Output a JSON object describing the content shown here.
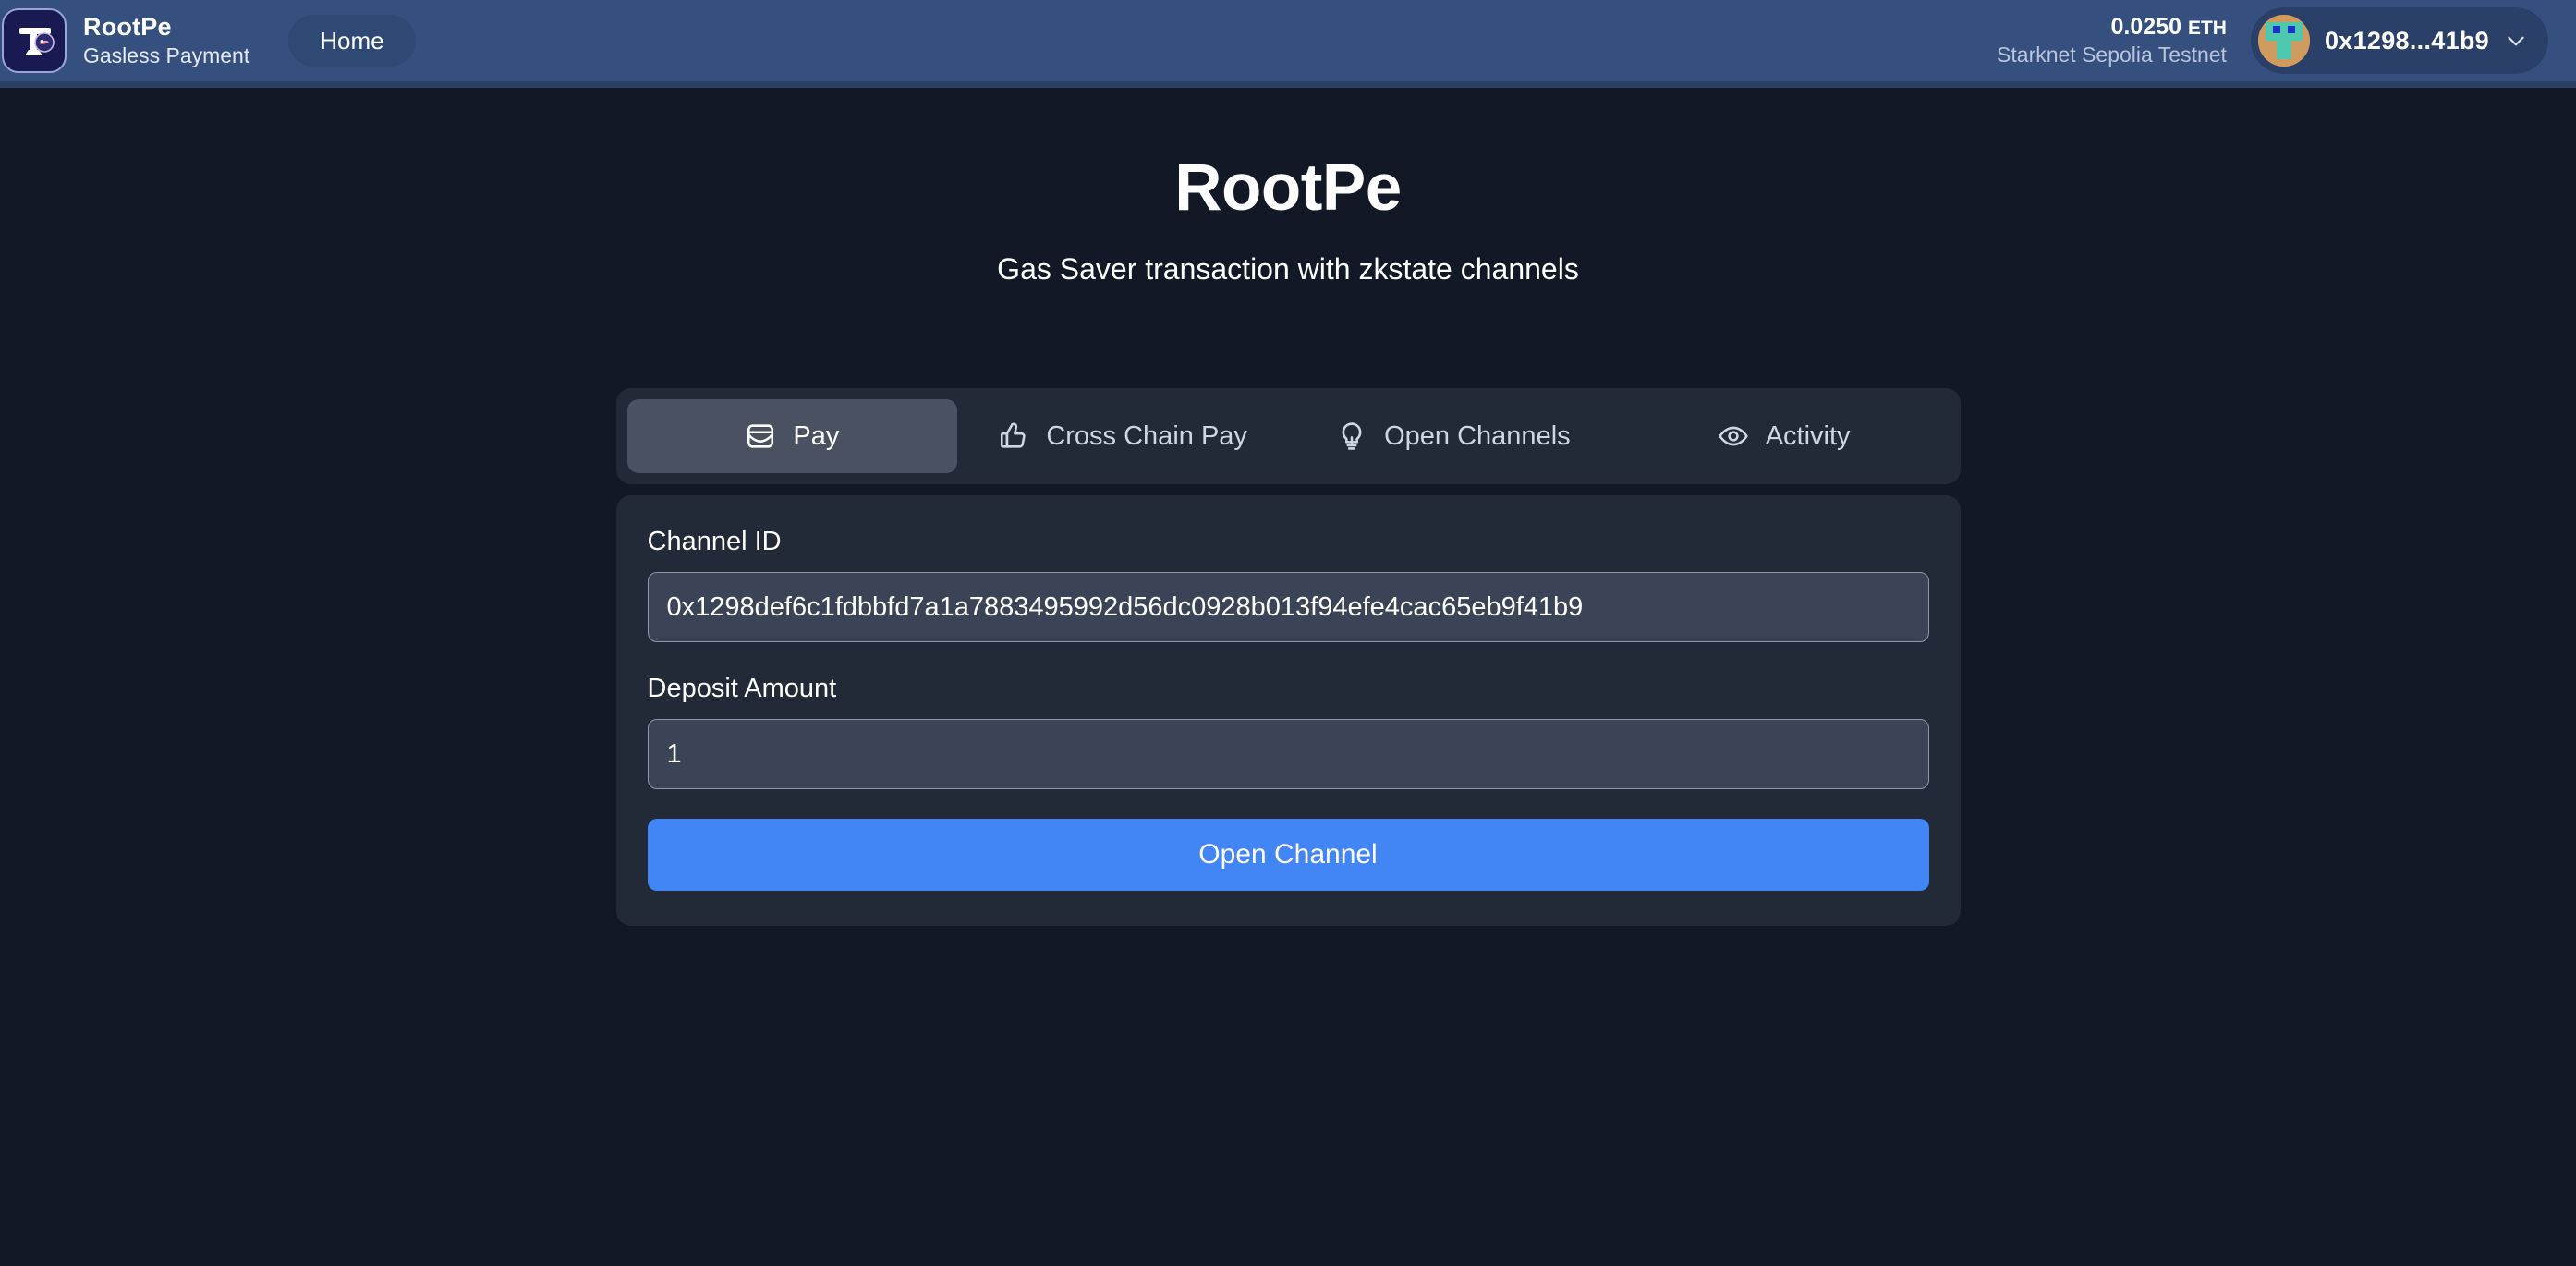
{
  "header": {
    "logo_icon": "rootpe-signpost-logo-icon",
    "brand_name": "RootPe",
    "brand_tagline": "Gasless Payment",
    "nav": {
      "home_label": "Home"
    },
    "wallet": {
      "balance_amount": "0.0250",
      "balance_unit": "ETH",
      "network": "Starknet Sepolia Testnet",
      "address_short": "0x1298...41b9",
      "avatar_icon": "wallet-avatar-icon",
      "chevron_icon": "chevron-down-icon"
    }
  },
  "hero": {
    "title": "RootPe",
    "subtitle": "Gas Saver transaction with zkstate channels"
  },
  "tabs": [
    {
      "label": "Pay",
      "icon": "wallet-icon",
      "active": true
    },
    {
      "label": "Cross Chain Pay",
      "icon": "thumbs-up-icon",
      "active": false
    },
    {
      "label": "Open Channels",
      "icon": "lightbulb-icon",
      "active": false
    },
    {
      "label": "Activity",
      "icon": "eye-icon",
      "active": false
    }
  ],
  "form": {
    "channel_id_label": "Channel ID",
    "channel_id_value": "0x1298def6c1fdbbfd7a1a7883495992d56dc0928b013f94efe4cac65eb9f41b9",
    "channel_id_placeholder": "Channel ID",
    "deposit_label": "Deposit Amount",
    "deposit_value": "1",
    "deposit_placeholder": "Deposit Amount",
    "submit_label": "Open Channel"
  },
  "colors": {
    "page_bg": "#121826",
    "header_bg": "#35507e",
    "card_bg": "#222a38",
    "input_bg": "#3a4456",
    "accent": "#4285f4",
    "active_tab_bg": "#4a5261"
  }
}
